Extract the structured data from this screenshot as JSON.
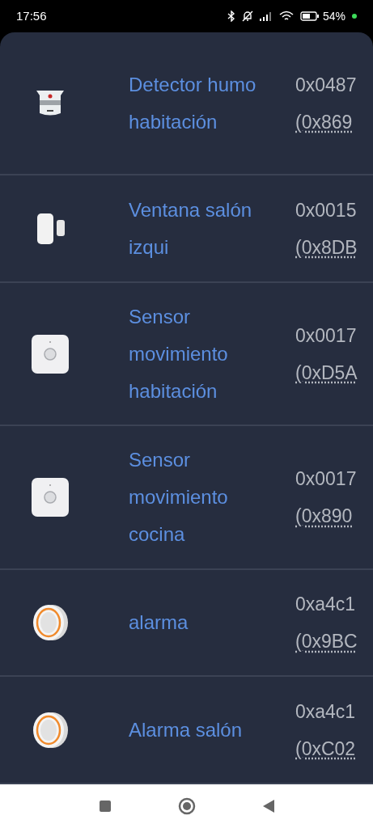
{
  "status_bar": {
    "time": "17:56",
    "battery": "54%"
  },
  "devices": [
    {
      "kind": "smoke",
      "name": "Detector humo habitación",
      "address": "0x0487",
      "network_address": "(0x869"
    },
    {
      "kind": "contact",
      "name": "Ventana salón izqui",
      "address": "0x0015",
      "network_address": "(0x8DB"
    },
    {
      "kind": "motion",
      "name": "Sensor movimiento habitación",
      "address": "0x0017",
      "network_address": "(0xD5A"
    },
    {
      "kind": "motion",
      "name": "Sensor movimiento cocina",
      "address": "0x0017",
      "network_address": "(0x890"
    },
    {
      "kind": "siren",
      "name": "alarma",
      "address": "0xa4c1",
      "network_address": "(0x9BC"
    },
    {
      "kind": "siren",
      "name": "Alarma salón",
      "address": "0xa4c1",
      "network_address": "(0xC02"
    }
  ]
}
